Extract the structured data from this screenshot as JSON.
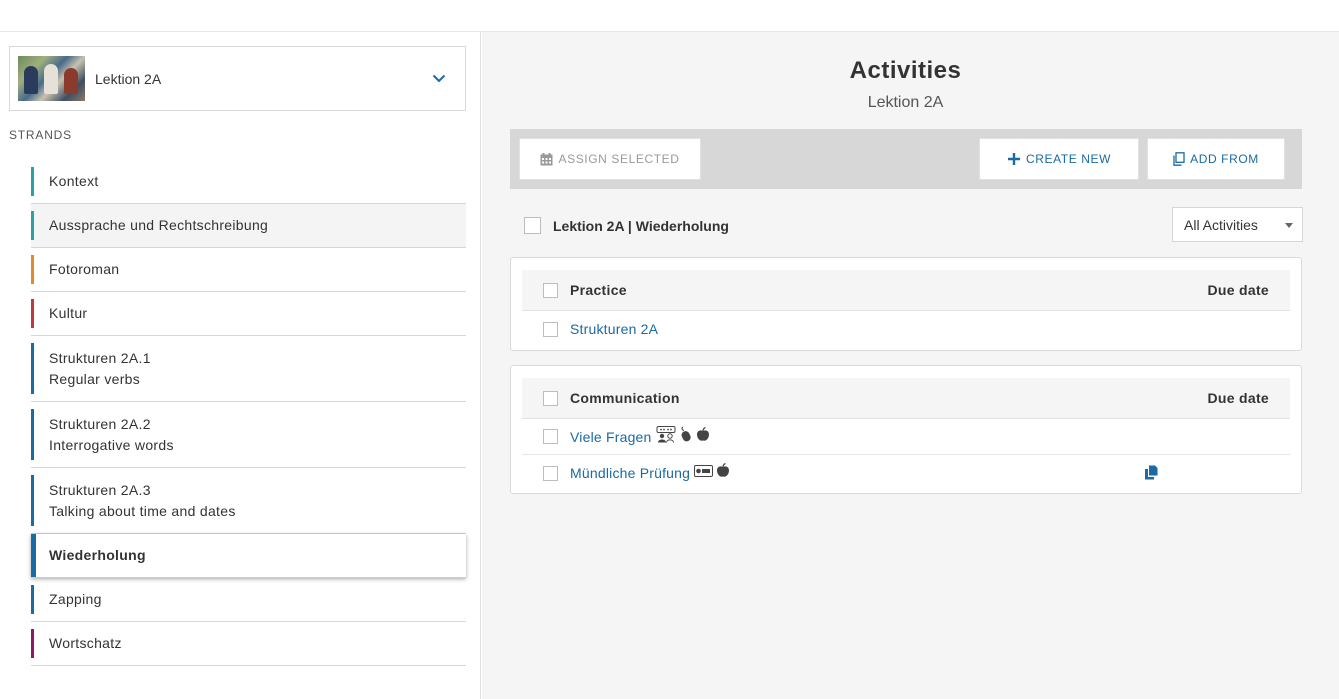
{
  "sidebar": {
    "lesson_select": {
      "label": "Lektion 2A"
    },
    "strands_title": "STRANDS",
    "strands": [
      {
        "label": "Kontext",
        "sublabel": "",
        "color": "#2aa0a8"
      },
      {
        "label": "Aussprache und Rechtschreibung",
        "sublabel": "",
        "color": "#2aa0a8"
      },
      {
        "label": "Fotoroman",
        "sublabel": "",
        "color": "#e08a2a"
      },
      {
        "label": "Kultur",
        "sublabel": "",
        "color": "#c0393b"
      },
      {
        "label": "Strukturen 2A.1",
        "sublabel": "Regular verbs",
        "color": "#1a6aa3"
      },
      {
        "label": "Strukturen 2A.2",
        "sublabel": "Interrogative words",
        "color": "#1a6aa3"
      },
      {
        "label": "Strukturen 2A.3",
        "sublabel": "Talking about time and dates",
        "color": "#1a6aa3"
      },
      {
        "label": "Wiederholung",
        "sublabel": "",
        "color": "#1a6aa3"
      },
      {
        "label": "Zapping",
        "sublabel": "",
        "color": "#1a6aa3"
      },
      {
        "label": "Wortschatz",
        "sublabel": "",
        "color": "#8a1a6a"
      }
    ]
  },
  "main": {
    "title": "Activities",
    "subtitle": "Lektion 2A",
    "toolbar": {
      "assign_label": "ASSIGN SELECTED",
      "create_label": "CREATE NEW",
      "add_from_label": "ADD FROM"
    },
    "selection_label": "Lektion 2A | Wiederholung",
    "filter": {
      "selected": "All Activities"
    },
    "sections": [
      {
        "heading": "Practice",
        "due_heading": "Due date",
        "items": [
          {
            "title": "Strukturen 2A"
          }
        ]
      },
      {
        "heading": "Communication",
        "due_heading": "Due date",
        "items": [
          {
            "title": "Viele Fragen",
            "icons": [
              "partner-chat-icon",
              "mouse-icon",
              "apple-icon"
            ]
          },
          {
            "title": "Mündliche Prüfung",
            "icons": [
              "record-icon",
              "apple-icon"
            ],
            "due_icon": "copy-icon"
          }
        ]
      }
    ]
  },
  "colors": {
    "link": "#1a6aa3",
    "toolbar_bg": "#d7d7d7",
    "main_bg": "#f5f5f5"
  }
}
